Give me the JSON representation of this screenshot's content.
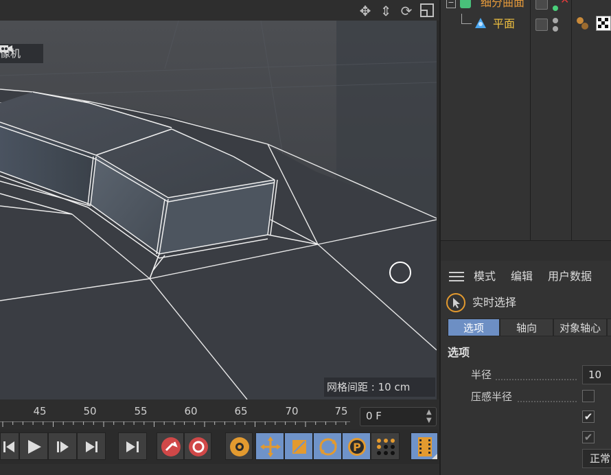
{
  "object_manager": {
    "items": [
      {
        "name": "细分曲面",
        "color": "#e79b3b"
      },
      {
        "name": "平面",
        "color": "#f0c040"
      }
    ]
  },
  "viewport": {
    "camera_label": "像机",
    "grid_spacing": "网格间距 : 10 cm",
    "nav_icons": [
      "move-view-icon",
      "zoom-view-icon",
      "rotate-view-icon",
      "toggle-layout-icon"
    ]
  },
  "attributes": {
    "menu": [
      "模式",
      "编辑",
      "用户数据"
    ],
    "mode_label": "实时选择",
    "tabs": [
      "选项",
      "轴向",
      "对象轴心"
    ],
    "section": "选项",
    "fields": {
      "radius_label": "半径",
      "radius_value": "10",
      "pressure_label": "压感半径",
      "normal_value": "正常"
    }
  },
  "timeline": {
    "ticks": [
      "45",
      "50",
      "55",
      "60",
      "65",
      "70",
      "75"
    ],
    "frame_value": "0 F"
  },
  "colors": {
    "accent": "#6f93c9",
    "tab_active": "#6d8fc4",
    "record": "#d04848",
    "tree_orange": "#e79b3b"
  }
}
